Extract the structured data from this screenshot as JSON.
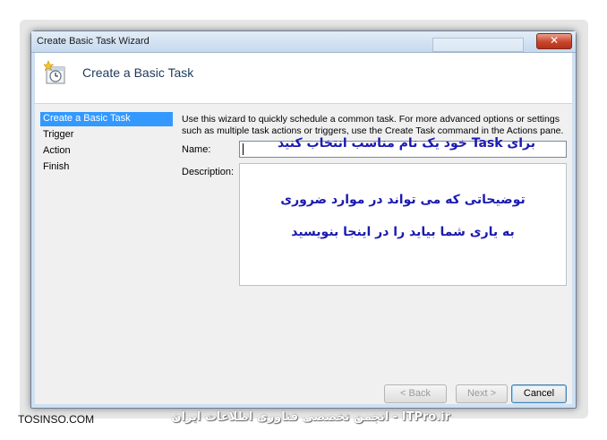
{
  "window": {
    "title": "Create Basic Task Wizard",
    "close_glyph": "✕"
  },
  "header": {
    "title": "Create a Basic Task",
    "icon": "task-scheduler-icon"
  },
  "steps": [
    {
      "label": "Create a Basic Task",
      "active": true
    },
    {
      "label": "Trigger",
      "active": false
    },
    {
      "label": "Action",
      "active": false
    },
    {
      "label": "Finish",
      "active": false
    }
  ],
  "intro": {
    "text": "Use this wizard to quickly schedule a common task.  For more advanced options or settings such as multiple task actions or triggers, use the Create Task command in the Actions pane."
  },
  "form": {
    "name_label": "Name:",
    "name_value": "",
    "description_label": "Description:",
    "description_value": ""
  },
  "annotations": {
    "name_hint": "برای Task خود یک نام مناسب انتخاب کنید",
    "desc_line1": "توضیحاتی که می تواند در موارد ضروری",
    "desc_line2": "به یاری شما بیاید را در اینجا بنویسید"
  },
  "buttons": {
    "back": "< Back",
    "next": "Next >",
    "cancel": "Cancel"
  },
  "branding": {
    "left": "TOSINSO.COM",
    "right": "ITPro.ir - انجمن تخصصی فناوری اطلاعات ایران"
  }
}
